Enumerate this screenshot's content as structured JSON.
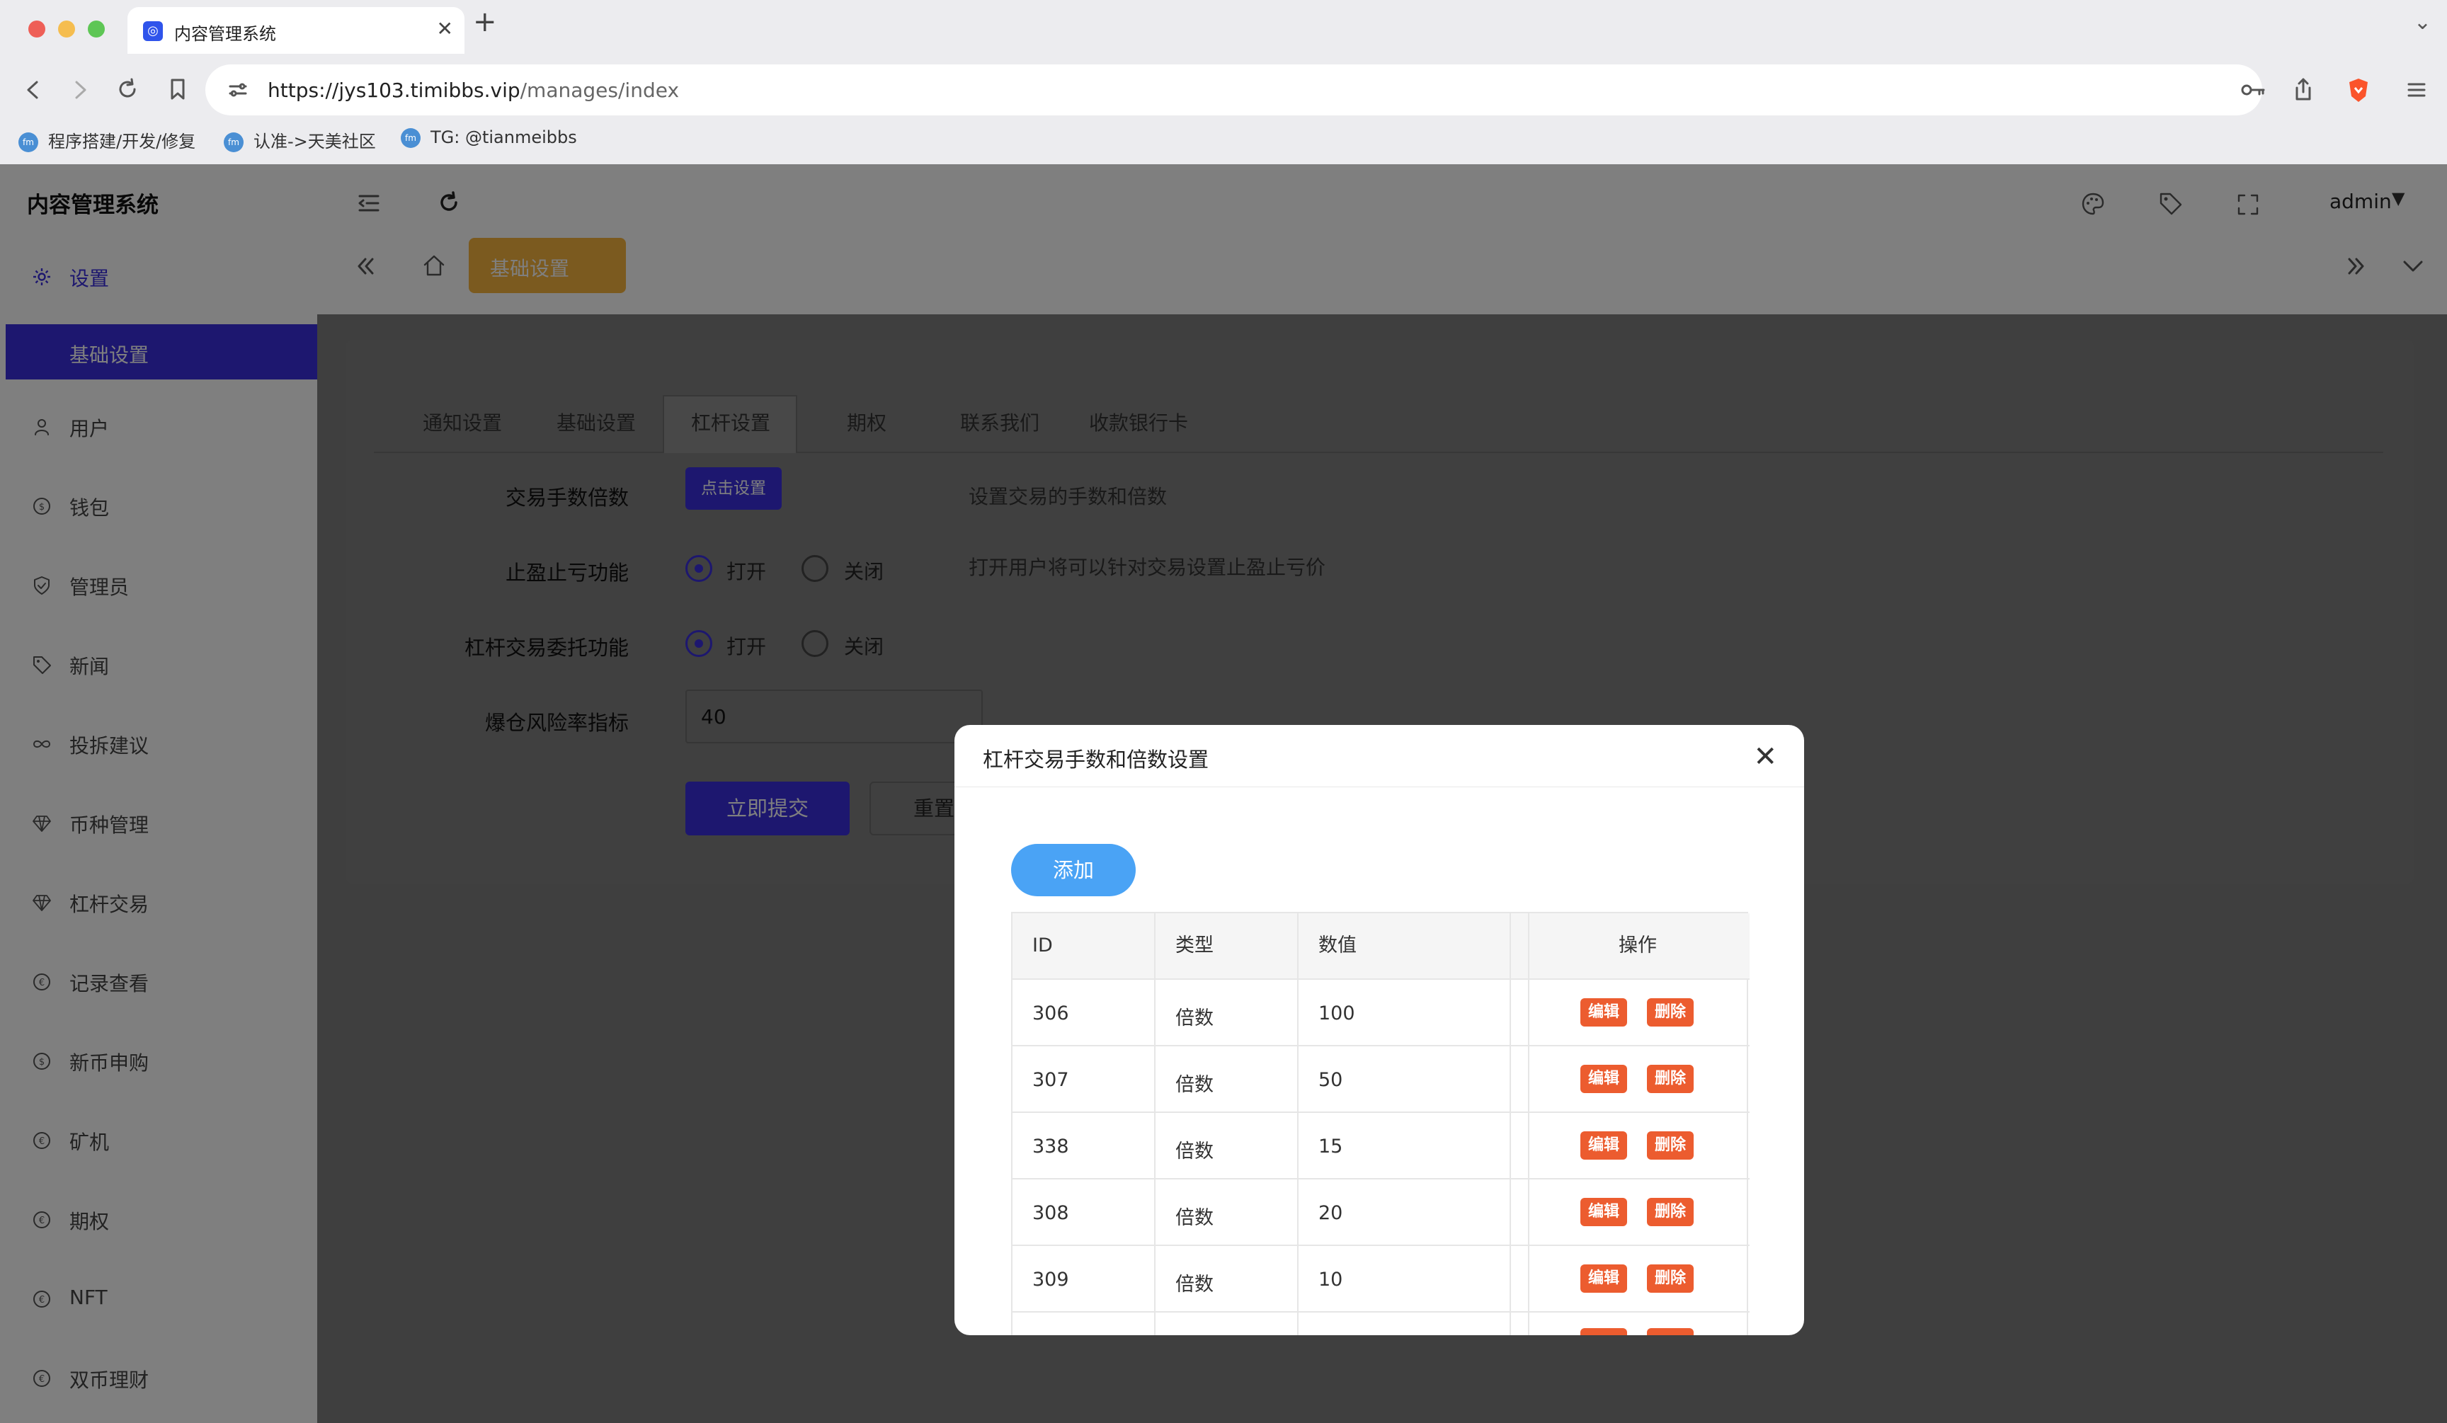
{
  "browser": {
    "tab_title": "内容管理系统",
    "url_host": "https://jys103.timibbs.vip",
    "url_path": "/manages/index",
    "bookmarks": [
      "程序搭建/开发/修复",
      "认准->天美社区",
      "TG: @tianmeibbs"
    ]
  },
  "app": {
    "brand": "内容管理系统",
    "user": "admin",
    "breadcrumb_tab": "基础设置",
    "accent_color": "#3b2fde"
  },
  "sidebar": {
    "items": [
      {
        "label": "设置",
        "icon": "gear-icon"
      },
      {
        "label": "用户",
        "icon": "user-icon"
      },
      {
        "label": "钱包",
        "icon": "coin-icon"
      },
      {
        "label": "管理员",
        "icon": "shield-icon"
      },
      {
        "label": "新闻",
        "icon": "tag-icon"
      },
      {
        "label": "投拆建议",
        "icon": "infinity-icon"
      },
      {
        "label": "币种管理",
        "icon": "diamond-icon"
      },
      {
        "label": "杠杆交易",
        "icon": "diamond-icon"
      },
      {
        "label": "记录查看",
        "icon": "coin-icon"
      },
      {
        "label": "新币申购",
        "icon": "coin-icon"
      },
      {
        "label": "矿机",
        "icon": "coin-icon"
      },
      {
        "label": "期权",
        "icon": "coin-icon"
      },
      {
        "label": "NFT",
        "icon": "coin-icon"
      },
      {
        "label": "双币理财",
        "icon": "coin-icon"
      }
    ],
    "sub_item": "基础设置"
  },
  "form": {
    "tabs": [
      "通知设置",
      "基础设置",
      "杠杆设置",
      "期权",
      "联系我们",
      "收款银行卡"
    ],
    "active_tab": "杠杆设置",
    "fields": {
      "fee_label": "交易手数倍数",
      "fee_button": "点击设置",
      "fee_help": "设置交易的手数和倍数",
      "stop_label": "止盈止亏功能",
      "stop_help": "打开用户将可以针对交易设置止盈止亏价",
      "entrust_label": "杠杆交易委托功能",
      "open": "打开",
      "close": "关闭",
      "risk_label": "爆仓风险率指标",
      "risk_value": "40"
    },
    "submit": "立即提交",
    "reset": "重置"
  },
  "modal": {
    "title": "杠杆交易手数和倍数设置",
    "add_button": "添加",
    "columns": [
      "ID",
      "类型",
      "数值",
      "操作"
    ],
    "rows": [
      {
        "id": "306",
        "type": "倍数",
        "value": "100"
      },
      {
        "id": "307",
        "type": "倍数",
        "value": "50"
      },
      {
        "id": "338",
        "type": "倍数",
        "value": "15"
      },
      {
        "id": "308",
        "type": "倍数",
        "value": "20"
      },
      {
        "id": "309",
        "type": "倍数",
        "value": "10"
      }
    ],
    "edit_label": "编辑",
    "delete_label": "删除"
  }
}
